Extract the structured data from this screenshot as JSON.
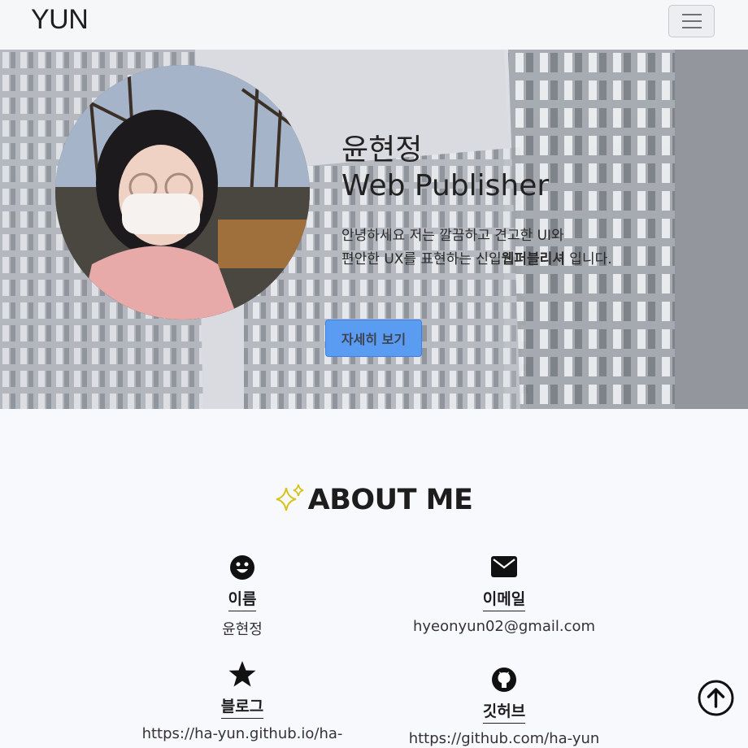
{
  "nav": {
    "brand": "YUN",
    "menu_icon": "hamburger-icon"
  },
  "hero": {
    "name": "윤현정",
    "role": "Web Publisher",
    "desc_line1": "안녕하세요 저는 깔끔하고 견고한 UI와",
    "desc_line2_pre": "편안한 UX를 표현하는 신입",
    "desc_line2_bold": "웹퍼블리셔",
    "desc_line2_post": " 입니다.",
    "button_label": "자세히 보기",
    "accent": "#5b9cf3"
  },
  "about": {
    "title": "ABOUT ME",
    "title_icon": "sparkle-icon",
    "items": [
      {
        "icon": "smiley-icon",
        "label": "이름",
        "value": "윤현정"
      },
      {
        "icon": "mail-icon",
        "label": "이메일",
        "value": "hyeonyun02@gmail.com"
      },
      {
        "icon": "star-icon",
        "label": "블로그",
        "value": "https://ha-yun.github.io/ha-"
      },
      {
        "icon": "github-icon",
        "label": "깃허브",
        "value": "https://github.com/ha-yun"
      }
    ]
  },
  "scroll_top_icon": "arrow-up-circle-icon"
}
